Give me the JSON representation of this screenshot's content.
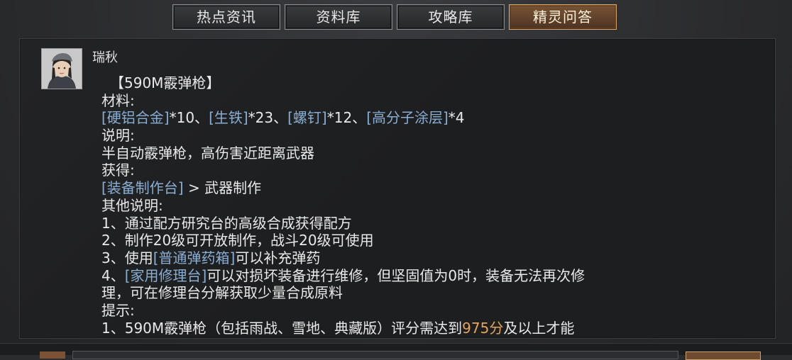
{
  "tabs": [
    {
      "label": "热点资讯",
      "active": false
    },
    {
      "label": "资料库",
      "active": false
    },
    {
      "label": "攻略库",
      "active": false
    },
    {
      "label": "精灵问答",
      "active": true
    }
  ],
  "colors": {
    "accent": "#d9a46a",
    "link": "#8aaed3",
    "highlight": "#e6a35c"
  },
  "message": {
    "sender": "瑞秋",
    "title": "【590M霰弹枪】",
    "materials_label": "材料:",
    "materials": [
      {
        "name": "[硬铝合金]",
        "qty": "*10、"
      },
      {
        "name": "[生铁]",
        "qty": "*23、"
      },
      {
        "name": "[螺钉]",
        "qty": "*12、"
      },
      {
        "name": "[高分子涂层]",
        "qty": "*4"
      }
    ],
    "desc_label": "说明:",
    "desc": "半自动霰弹枪，高伤害近距离武器",
    "obtain_label": "获得:",
    "obtain_link": "[装备制作台]",
    "obtain_rest": " > 武器制作",
    "other_label": "其他说明:",
    "other_1": "1、通过配方研究台的高级合成获得配方",
    "other_2": "2、制作20级可开放制作，战斗20级可使用",
    "other_3_pre": "3、使用",
    "other_3_link": "[普通弹药箱]",
    "other_3_post": "可以补充弹药",
    "other_4_pre": "4、",
    "other_4_link": "[家用修理台]",
    "other_4_post": "可以对损坏装备进行维修，但坚固值为0时，装备无法再次修",
    "other_4_cont": "理，可在修理台分解获取少量合成原料",
    "tip_label": "提示:",
    "tip_1_pre": "1、590M霰弹枪（包括雨战、雪地、典藏版）评分需达到",
    "tip_1_score": "975分",
    "tip_1_post": "及以上才能"
  }
}
